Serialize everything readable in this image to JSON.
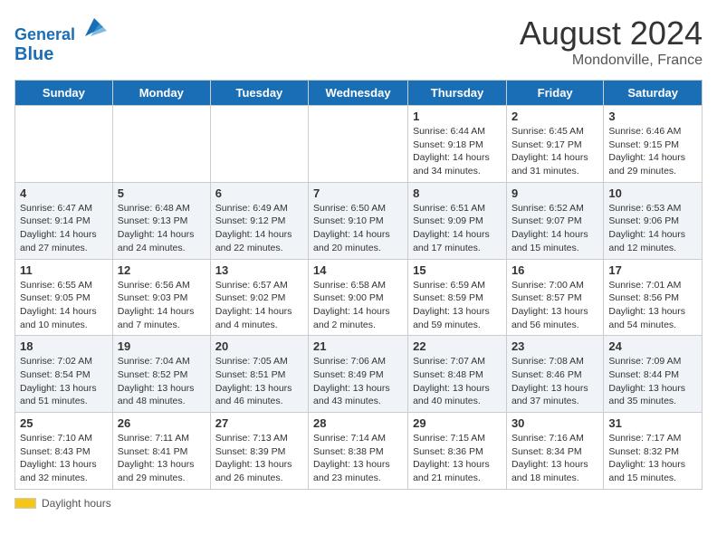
{
  "header": {
    "logo_line1": "General",
    "logo_line2": "Blue",
    "month": "August 2024",
    "location": "Mondonville, France"
  },
  "days_of_week": [
    "Sunday",
    "Monday",
    "Tuesday",
    "Wednesday",
    "Thursday",
    "Friday",
    "Saturday"
  ],
  "weeks": [
    [
      {
        "day": "",
        "info": ""
      },
      {
        "day": "",
        "info": ""
      },
      {
        "day": "",
        "info": ""
      },
      {
        "day": "",
        "info": ""
      },
      {
        "day": "1",
        "info": "Sunrise: 6:44 AM\nSunset: 9:18 PM\nDaylight: 14 hours\nand 34 minutes."
      },
      {
        "day": "2",
        "info": "Sunrise: 6:45 AM\nSunset: 9:17 PM\nDaylight: 14 hours\nand 31 minutes."
      },
      {
        "day": "3",
        "info": "Sunrise: 6:46 AM\nSunset: 9:15 PM\nDaylight: 14 hours\nand 29 minutes."
      }
    ],
    [
      {
        "day": "4",
        "info": "Sunrise: 6:47 AM\nSunset: 9:14 PM\nDaylight: 14 hours\nand 27 minutes."
      },
      {
        "day": "5",
        "info": "Sunrise: 6:48 AM\nSunset: 9:13 PM\nDaylight: 14 hours\nand 24 minutes."
      },
      {
        "day": "6",
        "info": "Sunrise: 6:49 AM\nSunset: 9:12 PM\nDaylight: 14 hours\nand 22 minutes."
      },
      {
        "day": "7",
        "info": "Sunrise: 6:50 AM\nSunset: 9:10 PM\nDaylight: 14 hours\nand 20 minutes."
      },
      {
        "day": "8",
        "info": "Sunrise: 6:51 AM\nSunset: 9:09 PM\nDaylight: 14 hours\nand 17 minutes."
      },
      {
        "day": "9",
        "info": "Sunrise: 6:52 AM\nSunset: 9:07 PM\nDaylight: 14 hours\nand 15 minutes."
      },
      {
        "day": "10",
        "info": "Sunrise: 6:53 AM\nSunset: 9:06 PM\nDaylight: 14 hours\nand 12 minutes."
      }
    ],
    [
      {
        "day": "11",
        "info": "Sunrise: 6:55 AM\nSunset: 9:05 PM\nDaylight: 14 hours\nand 10 minutes."
      },
      {
        "day": "12",
        "info": "Sunrise: 6:56 AM\nSunset: 9:03 PM\nDaylight: 14 hours\nand 7 minutes."
      },
      {
        "day": "13",
        "info": "Sunrise: 6:57 AM\nSunset: 9:02 PM\nDaylight: 14 hours\nand 4 minutes."
      },
      {
        "day": "14",
        "info": "Sunrise: 6:58 AM\nSunset: 9:00 PM\nDaylight: 14 hours\nand 2 minutes."
      },
      {
        "day": "15",
        "info": "Sunrise: 6:59 AM\nSunset: 8:59 PM\nDaylight: 13 hours\nand 59 minutes."
      },
      {
        "day": "16",
        "info": "Sunrise: 7:00 AM\nSunset: 8:57 PM\nDaylight: 13 hours\nand 56 minutes."
      },
      {
        "day": "17",
        "info": "Sunrise: 7:01 AM\nSunset: 8:56 PM\nDaylight: 13 hours\nand 54 minutes."
      }
    ],
    [
      {
        "day": "18",
        "info": "Sunrise: 7:02 AM\nSunset: 8:54 PM\nDaylight: 13 hours\nand 51 minutes."
      },
      {
        "day": "19",
        "info": "Sunrise: 7:04 AM\nSunset: 8:52 PM\nDaylight: 13 hours\nand 48 minutes."
      },
      {
        "day": "20",
        "info": "Sunrise: 7:05 AM\nSunset: 8:51 PM\nDaylight: 13 hours\nand 46 minutes."
      },
      {
        "day": "21",
        "info": "Sunrise: 7:06 AM\nSunset: 8:49 PM\nDaylight: 13 hours\nand 43 minutes."
      },
      {
        "day": "22",
        "info": "Sunrise: 7:07 AM\nSunset: 8:48 PM\nDaylight: 13 hours\nand 40 minutes."
      },
      {
        "day": "23",
        "info": "Sunrise: 7:08 AM\nSunset: 8:46 PM\nDaylight: 13 hours\nand 37 minutes."
      },
      {
        "day": "24",
        "info": "Sunrise: 7:09 AM\nSunset: 8:44 PM\nDaylight: 13 hours\nand 35 minutes."
      }
    ],
    [
      {
        "day": "25",
        "info": "Sunrise: 7:10 AM\nSunset: 8:43 PM\nDaylight: 13 hours\nand 32 minutes."
      },
      {
        "day": "26",
        "info": "Sunrise: 7:11 AM\nSunset: 8:41 PM\nDaylight: 13 hours\nand 29 minutes."
      },
      {
        "day": "27",
        "info": "Sunrise: 7:13 AM\nSunset: 8:39 PM\nDaylight: 13 hours\nand 26 minutes."
      },
      {
        "day": "28",
        "info": "Sunrise: 7:14 AM\nSunset: 8:38 PM\nDaylight: 13 hours\nand 23 minutes."
      },
      {
        "day": "29",
        "info": "Sunrise: 7:15 AM\nSunset: 8:36 PM\nDaylight: 13 hours\nand 21 minutes."
      },
      {
        "day": "30",
        "info": "Sunrise: 7:16 AM\nSunset: 8:34 PM\nDaylight: 13 hours\nand 18 minutes."
      },
      {
        "day": "31",
        "info": "Sunrise: 7:17 AM\nSunset: 8:32 PM\nDaylight: 13 hours\nand 15 minutes."
      }
    ]
  ],
  "footer": {
    "daylight_label": "Daylight hours"
  }
}
